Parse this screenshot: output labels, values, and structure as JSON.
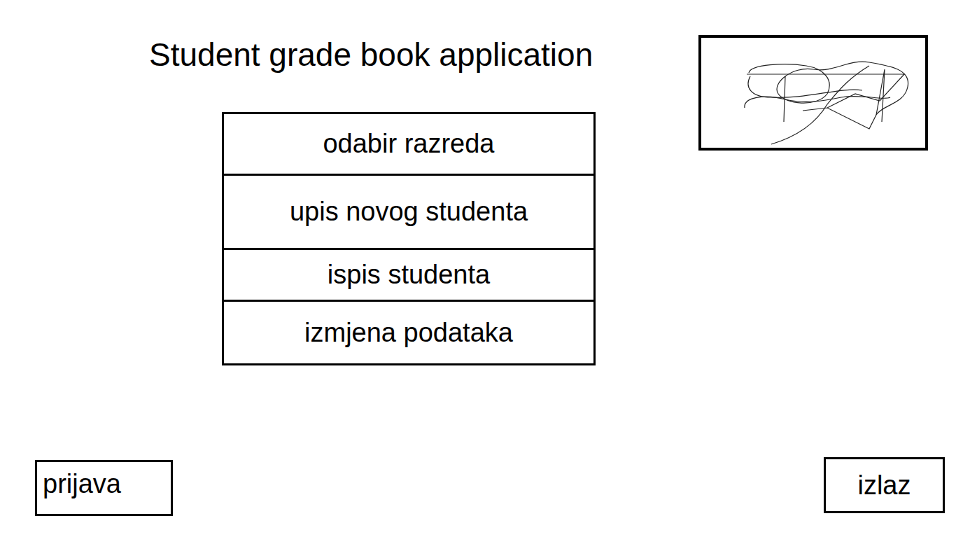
{
  "window": {
    "title": "Student grade book application"
  },
  "menu": {
    "items": [
      {
        "label": "odabir razreda"
      },
      {
        "label": "upis novog studenta"
      },
      {
        "label": "ispis studenta"
      },
      {
        "label": "izmjena podataka"
      }
    ]
  },
  "buttons": {
    "login": "prijava",
    "exit": "izlaz"
  }
}
